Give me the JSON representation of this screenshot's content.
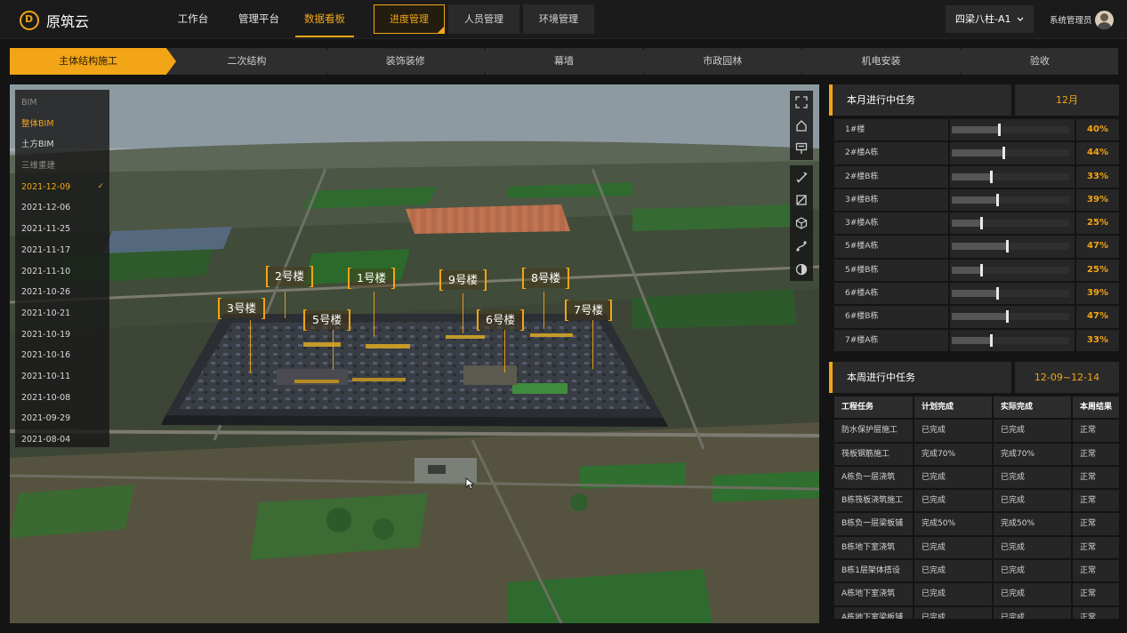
{
  "app": {
    "logo_text": "原筑云",
    "logo_icon": "d-circle-logo"
  },
  "main_nav": [
    {
      "label": "工作台",
      "active": false
    },
    {
      "label": "管理平台",
      "active": false
    },
    {
      "label": "数据看板",
      "active": true
    }
  ],
  "sub_nav": [
    {
      "label": "进度管理",
      "active": true
    },
    {
      "label": "人员管理",
      "active": false
    },
    {
      "label": "环境管理",
      "active": false
    }
  ],
  "project_select": {
    "value": "四梁八柱-A1",
    "icon": "chevron-down-icon"
  },
  "user": {
    "name": "系统管理员",
    "avatar": "user-avatar"
  },
  "stages": [
    {
      "label": "主体结构施工",
      "active": true
    },
    {
      "label": "二次结构",
      "active": false
    },
    {
      "label": "装饰装修",
      "active": false
    },
    {
      "label": "幕墙",
      "active": false
    },
    {
      "label": "市政园林",
      "active": false
    },
    {
      "label": "机电安装",
      "active": false
    },
    {
      "label": "验收",
      "active": false
    }
  ],
  "bim_menu": {
    "items": [
      {
        "label": "BIM",
        "state": "muted"
      },
      {
        "label": "整体BIM",
        "state": "active"
      },
      {
        "label": "土方BIM",
        "state": "normal"
      },
      {
        "label": "三维重建",
        "state": "muted"
      },
      {
        "label": "2021-12-09",
        "state": "active",
        "checked": true
      },
      {
        "label": "2021-12-06",
        "state": "normal"
      },
      {
        "label": "2021-11-25",
        "state": "normal"
      },
      {
        "label": "2021-11-17",
        "state": "normal"
      },
      {
        "label": "2021-11-10",
        "state": "normal"
      },
      {
        "label": "2021-10-26",
        "state": "normal"
      },
      {
        "label": "2021-10-21",
        "state": "normal"
      },
      {
        "label": "2021-10-19",
        "state": "normal"
      },
      {
        "label": "2021-10-16",
        "state": "normal"
      },
      {
        "label": "2021-10-11",
        "state": "normal"
      },
      {
        "label": "2021-10-08",
        "state": "normal"
      },
      {
        "label": "2021-09-29",
        "state": "normal"
      },
      {
        "label": "2021-08-04",
        "state": "normal"
      }
    ],
    "check_glyph": "✓"
  },
  "tools": {
    "group1": [
      "fullscreen-icon",
      "home-icon",
      "annotation-icon"
    ],
    "group2": [
      "measure-ruler-icon",
      "area-measure-icon",
      "cube-icon",
      "path-icon",
      "shadow-icon"
    ]
  },
  "buildings": [
    "2号楼",
    "1号楼",
    "9号楼",
    "8号楼",
    "3号楼",
    "5号楼",
    "6号楼",
    "7号楼"
  ],
  "monthly": {
    "title": "本月进行中任务",
    "period": "12月",
    "rows": [
      {
        "name": "1#楼",
        "progress": 0.4,
        "label": "40%"
      },
      {
        "name": "2#楼A栋",
        "progress": 0.44,
        "label": "44%"
      },
      {
        "name": "2#楼B栋",
        "progress": 0.33,
        "label": "33%"
      },
      {
        "name": "3#楼B栋",
        "progress": 0.39,
        "label": "39%"
      },
      {
        "name": "3#楼A栋",
        "progress": 0.25,
        "label": "25%"
      },
      {
        "name": "5#楼A栋",
        "progress": 0.47,
        "label": "47%"
      },
      {
        "name": "5#楼B栋",
        "progress": 0.25,
        "label": "25%"
      },
      {
        "name": "6#楼A栋",
        "progress": 0.39,
        "label": "39%"
      },
      {
        "name": "6#楼B栋",
        "progress": 0.47,
        "label": "47%"
      },
      {
        "name": "7#楼A栋",
        "progress": 0.33,
        "label": "33%"
      }
    ]
  },
  "weekly": {
    "title": "本周进行中任务",
    "period": "12-09~12-14",
    "columns": [
      "工程任务",
      "计划完成",
      "实际完成",
      "本周结果"
    ],
    "rows": [
      [
        "防水保护层施工",
        "已完成",
        "已完成",
        "正常"
      ],
      [
        "筏板钢筋施工",
        "完成70%",
        "完成70%",
        "正常"
      ],
      [
        "A栋负一层浇筑",
        "已完成",
        "已完成",
        "正常"
      ],
      [
        "B栋筏板浇筑施工",
        "已完成",
        "已完成",
        "正常"
      ],
      [
        "B栋负一层梁板铺",
        "完成50%",
        "完成50%",
        "正常"
      ],
      [
        "B栋地下室浇筑",
        "已完成",
        "已完成",
        "正常"
      ],
      [
        "B栋1层架体搭设",
        "已完成",
        "已完成",
        "正常"
      ],
      [
        "A栋地下室浇筑",
        "已完成",
        "已完成",
        "正常"
      ],
      [
        "A栋地下室梁板铺",
        "已完成",
        "已完成",
        "正常"
      ]
    ]
  },
  "colors": {
    "accent": "#f2a516",
    "panel": "#262626",
    "background": "#141414"
  }
}
